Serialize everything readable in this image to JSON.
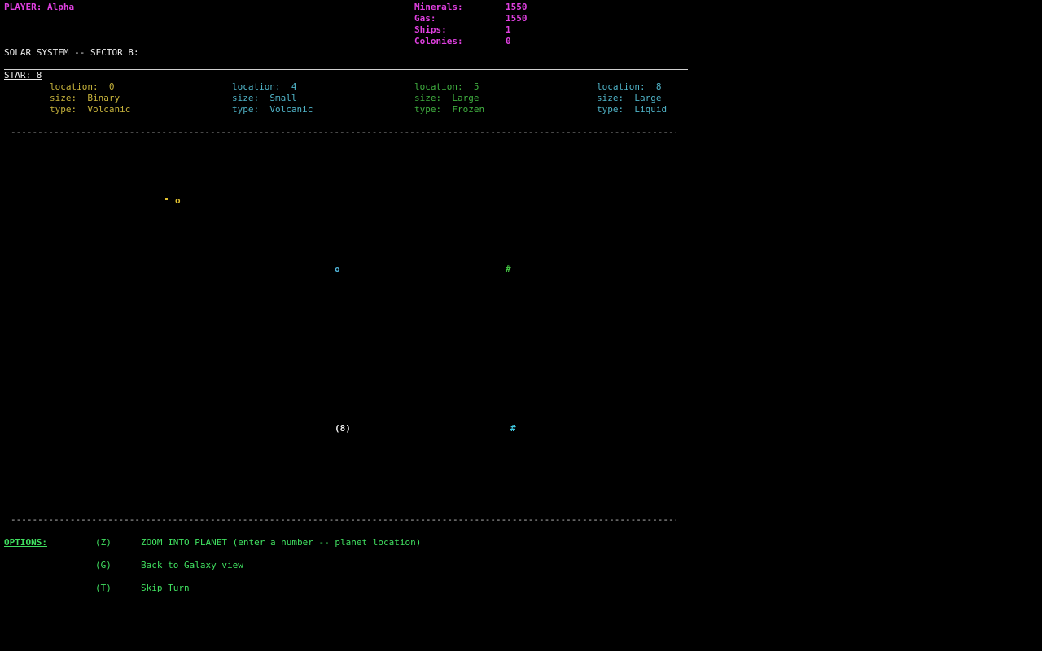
{
  "header": {
    "player_label": "PLAYER: Alpha",
    "sector_title": "SOLAR SYSTEM -- SECTOR 8:",
    "star_label": "STAR: 8"
  },
  "resources": [
    {
      "label": "Minerals:",
      "value": "1550"
    },
    {
      "label": "Gas:",
      "value": "1550"
    },
    {
      "label": "Ships:",
      "value": "1"
    },
    {
      "label": "Colonies:",
      "value": "0"
    }
  ],
  "planets": [
    {
      "location": "location:  0",
      "size": "size:  Binary",
      "type": "type:  Volcanic",
      "color": "#c8b43c"
    },
    {
      "location": "location:  4",
      "size": "size:  Small",
      "type": "type:  Volcanic",
      "color": "#50b4c8"
    },
    {
      "location": "location:  5",
      "size": "size:  Large",
      "type": "type:  Frozen",
      "color": "#40b040"
    },
    {
      "location": "location:  8",
      "size": "size:  Large",
      "type": "type:  Liquid",
      "color": "#50b4c8"
    }
  ],
  "map": {
    "markers": [
      {
        "glyph": "o",
        "color": "#e0c030"
      },
      {
        "glyph": "o",
        "color": "#50b4d8"
      },
      {
        "glyph": "#",
        "color": "#40c040"
      },
      {
        "glyph": "(8)",
        "color": "#f0f0f0"
      },
      {
        "glyph": "#",
        "color": "#40c8e0"
      }
    ],
    "dot_color": "#e0c030"
  },
  "options": {
    "label": "OPTIONS:",
    "items": [
      {
        "key": "(Z)",
        "text": "ZOOM INTO PLANET (enter a number -- planet location)"
      },
      {
        "key": "(G)",
        "text": "Back to Galaxy view"
      },
      {
        "key": "(T)",
        "text": "Skip Turn"
      }
    ]
  },
  "colors": {
    "background": "#000000",
    "player": "#e040e0",
    "options": "#40e060"
  }
}
